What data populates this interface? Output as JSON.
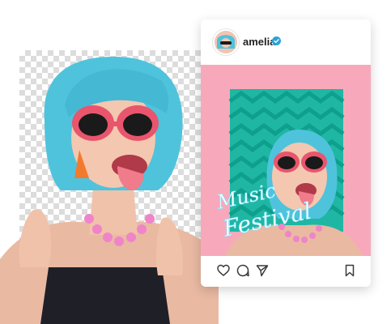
{
  "profile": {
    "username": "amelia",
    "verified": true
  },
  "post": {
    "caption_line1": "Music",
    "caption_line2": "Festival"
  },
  "icons": {
    "like": "heart-icon",
    "comment": "comment-icon",
    "share": "share-icon",
    "save": "bookmark-icon",
    "verified": "verified-badge-icon"
  },
  "colors": {
    "post_background": "#f7a9bb",
    "pattern_teal": "#1fb7a4",
    "hair": "#4fc3dc",
    "verified": "#2aa3d8"
  }
}
